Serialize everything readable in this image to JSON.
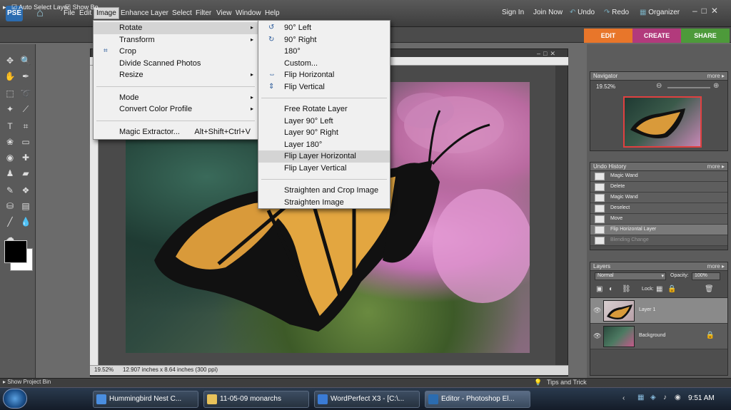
{
  "app": {
    "logo_text": "PSE"
  },
  "menubar": {
    "items": [
      "File",
      "Edit",
      "Image",
      "Enhance",
      "Layer",
      "Select",
      "Filter",
      "View",
      "Window",
      "Help"
    ],
    "sign_in": "Sign In",
    "join_now": "Join Now",
    "undo": "Undo",
    "redo": "Redo",
    "organizer": "Organizer"
  },
  "options_bar": {
    "auto_select_layer": "Auto Select Layer",
    "show_bounding": "Show Bo"
  },
  "mode_tabs": {
    "edit": "EDIT",
    "create": "CREATE",
    "share": "SHARE"
  },
  "image_menu": {
    "items": [
      {
        "label": "Rotate",
        "arrow": "▸"
      },
      {
        "label": "Transform",
        "arrow": "▸"
      },
      {
        "label": "Crop"
      },
      {
        "label": "Divide Scanned Photos"
      },
      {
        "label": "Resize",
        "arrow": "▸"
      },
      {
        "label": "Mode",
        "arrow": "▸"
      },
      {
        "label": "Convert Color Profile",
        "arrow": "▸"
      },
      {
        "label": "Magic Extractor...",
        "shortcut": "Alt+Shift+Ctrl+V"
      }
    ]
  },
  "rotate_submenu": {
    "items": [
      "90° Left",
      "90° Right",
      "180°",
      "Custom...",
      "Flip Horizontal",
      "Flip Vertical",
      "Free Rotate Layer",
      "Layer 90° Left",
      "Layer 90° Right",
      "Layer 180°",
      "Flip Layer Horizontal",
      "Flip Layer Vertical",
      "Straighten and Crop Image",
      "Straighten Image"
    ]
  },
  "document": {
    "zoom": "19.52%",
    "dimensions": "12.907 inches x 8.64 inches (300 ppi)"
  },
  "navigator": {
    "title": "Navigator",
    "more": "more ▸",
    "zoom": "19.52%"
  },
  "undo_history": {
    "title": "Undo History",
    "more": "more ▸",
    "items": [
      "Magic Wand",
      "Delete",
      "Magic Wand",
      "Deselect",
      "Move",
      "Flip Horizontal Layer",
      "Blending Change"
    ]
  },
  "layers": {
    "title": "Layers",
    "more": "more ▸",
    "blend_mode": "Normal",
    "opacity_label": "Opacity:",
    "opacity": "100%",
    "lock_label": "Lock:",
    "items": [
      "Layer 1",
      "Background"
    ]
  },
  "bottom": {
    "project_bin": "Show Project Bin",
    "tips": "Tips and Trick"
  },
  "taskbar": {
    "tasks": [
      "Hummingbird Nest C...",
      "11-05-09 monarchs",
      "WordPerfect X3 - [C:\\...",
      "Editor - Photoshop El..."
    ],
    "clock": "9:51 AM"
  },
  "colors": {
    "edit_tab": "#e8762a",
    "create_tab": "#b23a7c",
    "share_tab": "#4d9a3a",
    "menu_highlight": "#d4d4d4"
  }
}
